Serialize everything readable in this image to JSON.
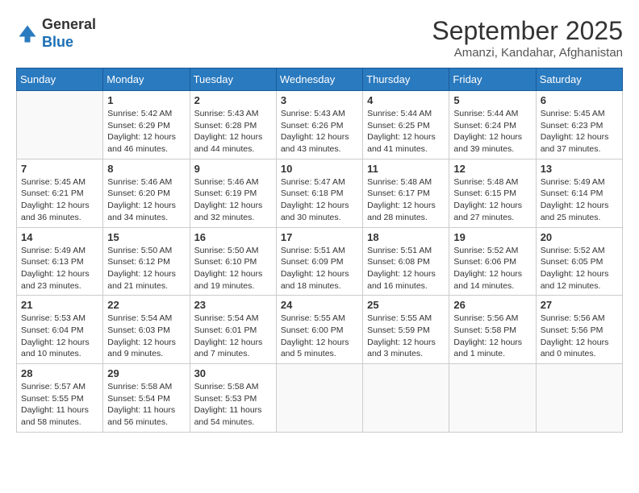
{
  "header": {
    "logo_general": "General",
    "logo_blue": "Blue",
    "month_title": "September 2025",
    "location": "Amanzi, Kandahar, Afghanistan"
  },
  "weekdays": [
    "Sunday",
    "Monday",
    "Tuesday",
    "Wednesday",
    "Thursday",
    "Friday",
    "Saturday"
  ],
  "weeks": [
    [
      {
        "day": "",
        "info": ""
      },
      {
        "day": "1",
        "info": "Sunrise: 5:42 AM\nSunset: 6:29 PM\nDaylight: 12 hours\nand 46 minutes."
      },
      {
        "day": "2",
        "info": "Sunrise: 5:43 AM\nSunset: 6:28 PM\nDaylight: 12 hours\nand 44 minutes."
      },
      {
        "day": "3",
        "info": "Sunrise: 5:43 AM\nSunset: 6:26 PM\nDaylight: 12 hours\nand 43 minutes."
      },
      {
        "day": "4",
        "info": "Sunrise: 5:44 AM\nSunset: 6:25 PM\nDaylight: 12 hours\nand 41 minutes."
      },
      {
        "day": "5",
        "info": "Sunrise: 5:44 AM\nSunset: 6:24 PM\nDaylight: 12 hours\nand 39 minutes."
      },
      {
        "day": "6",
        "info": "Sunrise: 5:45 AM\nSunset: 6:23 PM\nDaylight: 12 hours\nand 37 minutes."
      }
    ],
    [
      {
        "day": "7",
        "info": "Sunrise: 5:45 AM\nSunset: 6:21 PM\nDaylight: 12 hours\nand 36 minutes."
      },
      {
        "day": "8",
        "info": "Sunrise: 5:46 AM\nSunset: 6:20 PM\nDaylight: 12 hours\nand 34 minutes."
      },
      {
        "day": "9",
        "info": "Sunrise: 5:46 AM\nSunset: 6:19 PM\nDaylight: 12 hours\nand 32 minutes."
      },
      {
        "day": "10",
        "info": "Sunrise: 5:47 AM\nSunset: 6:18 PM\nDaylight: 12 hours\nand 30 minutes."
      },
      {
        "day": "11",
        "info": "Sunrise: 5:48 AM\nSunset: 6:17 PM\nDaylight: 12 hours\nand 28 minutes."
      },
      {
        "day": "12",
        "info": "Sunrise: 5:48 AM\nSunset: 6:15 PM\nDaylight: 12 hours\nand 27 minutes."
      },
      {
        "day": "13",
        "info": "Sunrise: 5:49 AM\nSunset: 6:14 PM\nDaylight: 12 hours\nand 25 minutes."
      }
    ],
    [
      {
        "day": "14",
        "info": "Sunrise: 5:49 AM\nSunset: 6:13 PM\nDaylight: 12 hours\nand 23 minutes."
      },
      {
        "day": "15",
        "info": "Sunrise: 5:50 AM\nSunset: 6:12 PM\nDaylight: 12 hours\nand 21 minutes."
      },
      {
        "day": "16",
        "info": "Sunrise: 5:50 AM\nSunset: 6:10 PM\nDaylight: 12 hours\nand 19 minutes."
      },
      {
        "day": "17",
        "info": "Sunrise: 5:51 AM\nSunset: 6:09 PM\nDaylight: 12 hours\nand 18 minutes."
      },
      {
        "day": "18",
        "info": "Sunrise: 5:51 AM\nSunset: 6:08 PM\nDaylight: 12 hours\nand 16 minutes."
      },
      {
        "day": "19",
        "info": "Sunrise: 5:52 AM\nSunset: 6:06 PM\nDaylight: 12 hours\nand 14 minutes."
      },
      {
        "day": "20",
        "info": "Sunrise: 5:52 AM\nSunset: 6:05 PM\nDaylight: 12 hours\nand 12 minutes."
      }
    ],
    [
      {
        "day": "21",
        "info": "Sunrise: 5:53 AM\nSunset: 6:04 PM\nDaylight: 12 hours\nand 10 minutes."
      },
      {
        "day": "22",
        "info": "Sunrise: 5:54 AM\nSunset: 6:03 PM\nDaylight: 12 hours\nand 9 minutes."
      },
      {
        "day": "23",
        "info": "Sunrise: 5:54 AM\nSunset: 6:01 PM\nDaylight: 12 hours\nand 7 minutes."
      },
      {
        "day": "24",
        "info": "Sunrise: 5:55 AM\nSunset: 6:00 PM\nDaylight: 12 hours\nand 5 minutes."
      },
      {
        "day": "25",
        "info": "Sunrise: 5:55 AM\nSunset: 5:59 PM\nDaylight: 12 hours\nand 3 minutes."
      },
      {
        "day": "26",
        "info": "Sunrise: 5:56 AM\nSunset: 5:58 PM\nDaylight: 12 hours\nand 1 minute."
      },
      {
        "day": "27",
        "info": "Sunrise: 5:56 AM\nSunset: 5:56 PM\nDaylight: 12 hours\nand 0 minutes."
      }
    ],
    [
      {
        "day": "28",
        "info": "Sunrise: 5:57 AM\nSunset: 5:55 PM\nDaylight: 11 hours\nand 58 minutes."
      },
      {
        "day": "29",
        "info": "Sunrise: 5:58 AM\nSunset: 5:54 PM\nDaylight: 11 hours\nand 56 minutes."
      },
      {
        "day": "30",
        "info": "Sunrise: 5:58 AM\nSunset: 5:53 PM\nDaylight: 11 hours\nand 54 minutes."
      },
      {
        "day": "",
        "info": ""
      },
      {
        "day": "",
        "info": ""
      },
      {
        "day": "",
        "info": ""
      },
      {
        "day": "",
        "info": ""
      }
    ]
  ]
}
